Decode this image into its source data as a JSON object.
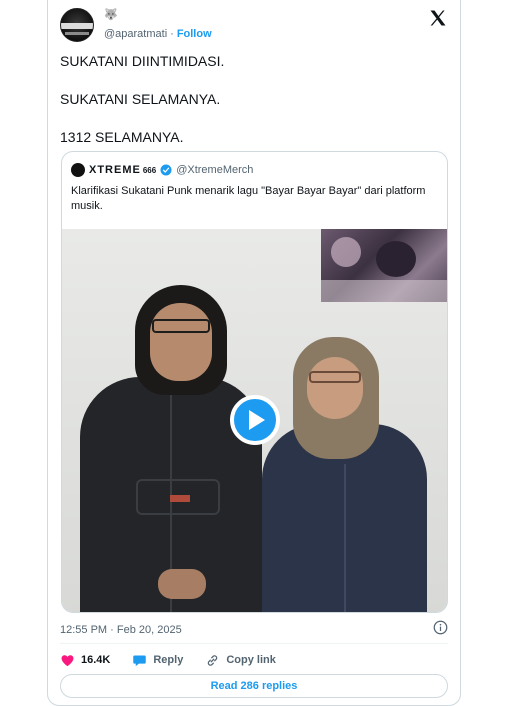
{
  "tweet": {
    "display_name": "🐺",
    "handle": "@aparatmati",
    "separator": "·",
    "follow_label": "Follow",
    "text_lines": [
      "SUKATANI DIINTIMIDASI.",
      "SUKATANI SELAMANYA.",
      "1312 SELAMANYA."
    ],
    "timestamp": "12:55 PM · Feb 20, 2025"
  },
  "quote": {
    "name": "XTREME",
    "name_suffix": "666",
    "handle": "@XtremeMerch",
    "text": "Klarifikasi Sukatani Punk menarik lagu \"Bayar Bayar Bayar\" dari platform musik."
  },
  "actions": {
    "like_count": "16.4K",
    "reply_label": "Reply",
    "copy_link_label": "Copy link"
  },
  "read_replies_label": "Read 286 replies",
  "colors": {
    "accent": "#1d9bf0",
    "like": "#f91880",
    "text": "#0f1419",
    "secondary": "#536471"
  },
  "icons": [
    "x-logo-icon",
    "verified-icon",
    "play-icon",
    "info-icon",
    "heart-icon",
    "reply-icon",
    "link-icon"
  ]
}
